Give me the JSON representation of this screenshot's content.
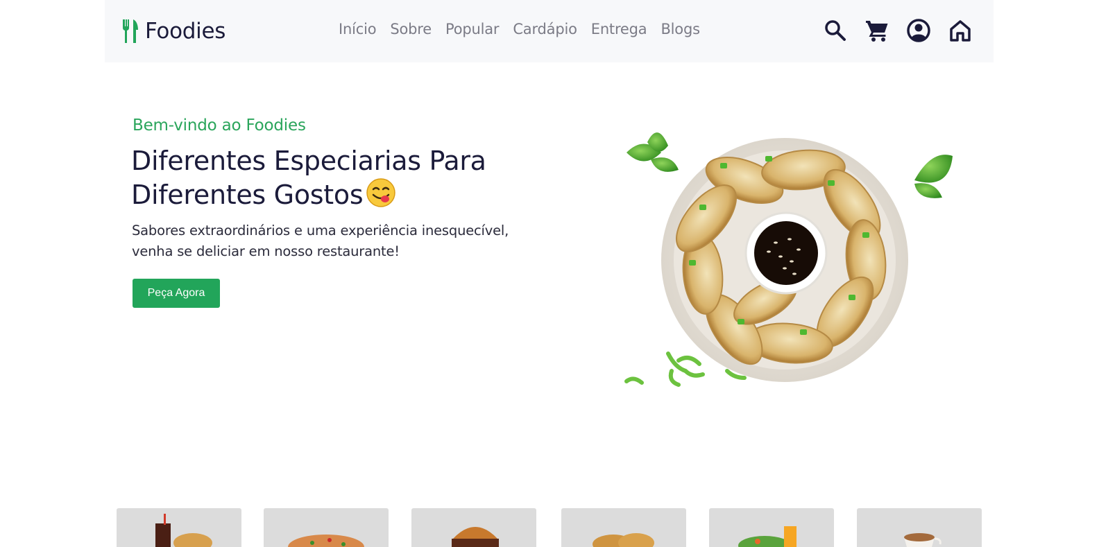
{
  "brand": {
    "name": "Foodies",
    "icon": "fork-knife-icon",
    "accent": "#22a55a"
  },
  "nav": {
    "links": [
      "Início",
      "Sobre",
      "Popular",
      "Cardápio",
      "Entrega",
      "Blogs"
    ],
    "icons": [
      "search-icon",
      "cart-icon",
      "user-icon",
      "home-icon"
    ]
  },
  "hero": {
    "eyebrow": "Bem-vindo ao Foodies",
    "title": "Diferentes Especiarias Para Diferentes Gostos",
    "emoji": "yum-face-emoji",
    "text": "Sabores extraordinários e uma experiência inesquecível, venha se deliciar em nosso restaurante!",
    "button": "Peça Agora",
    "image": "dumplings-plate-image"
  },
  "categories": [
    "fast-food-image",
    "pizza-image",
    "burger-image",
    "fried-chicken-image",
    "salad-image",
    "coffee-image"
  ],
  "colors": {
    "navbar_bg": "#f7f8fa",
    "primary_text": "#1b1b3a",
    "green": "#22a55a",
    "card_bg": "#dcdcdc"
  }
}
